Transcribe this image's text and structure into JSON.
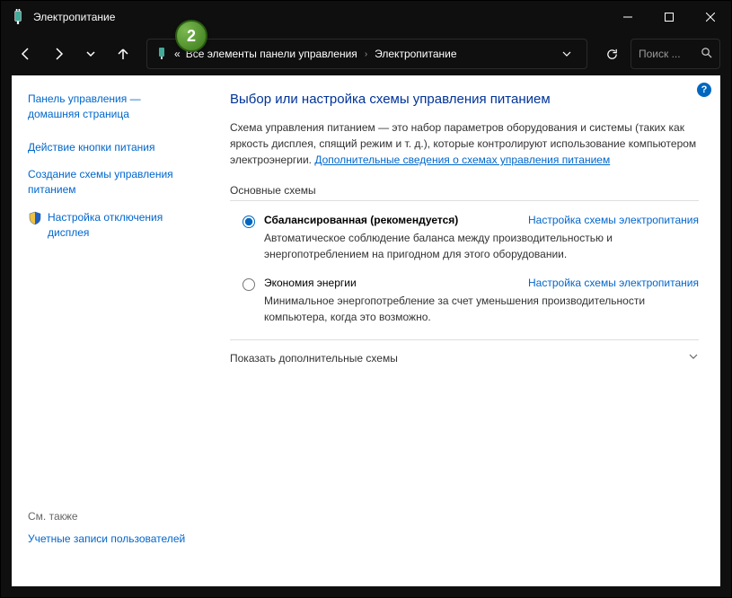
{
  "titlebar": {
    "title": "Электропитание"
  },
  "breadcrumb": {
    "prefix": "«",
    "item1": "Все элементы панели управления",
    "item2": "Электропитание"
  },
  "search": {
    "placeholder": "Поиск ..."
  },
  "sidebar": {
    "link1": "Панель управления — домашняя страница",
    "link2": "Действие кнопки питания",
    "link3": "Создание схемы управления питанием",
    "link4": "Настройка отключения дисплея",
    "seealso": "См. также",
    "link5": "Учетные записи пользователей"
  },
  "main": {
    "heading": "Выбор или настройка схемы управления питанием",
    "desc_pre": "Схема управления питанием — это набор параметров оборудования и системы (таких как яркость дисплея, спящий режим и т. д.), которые контролируют использование компьютером электроэнергии. ",
    "desc_link": "Дополнительные сведения о схемах управления питанием",
    "group_label": "Основные схемы",
    "plan1": {
      "name": "Сбалансированная (рекомендуется)",
      "link": "Настройка схемы электропитания",
      "desc": "Автоматическое соблюдение баланса между производительностью и энергопотреблением на пригодном для этого оборудовании."
    },
    "plan2": {
      "name": "Экономия энергии",
      "link": "Настройка схемы электропитания",
      "desc": "Минимальное энергопотребление за счет уменьшения производительности компьютера, когда это возможно."
    },
    "expander": "Показать дополнительные схемы"
  },
  "badge": {
    "step": "2",
    "help": "?"
  }
}
